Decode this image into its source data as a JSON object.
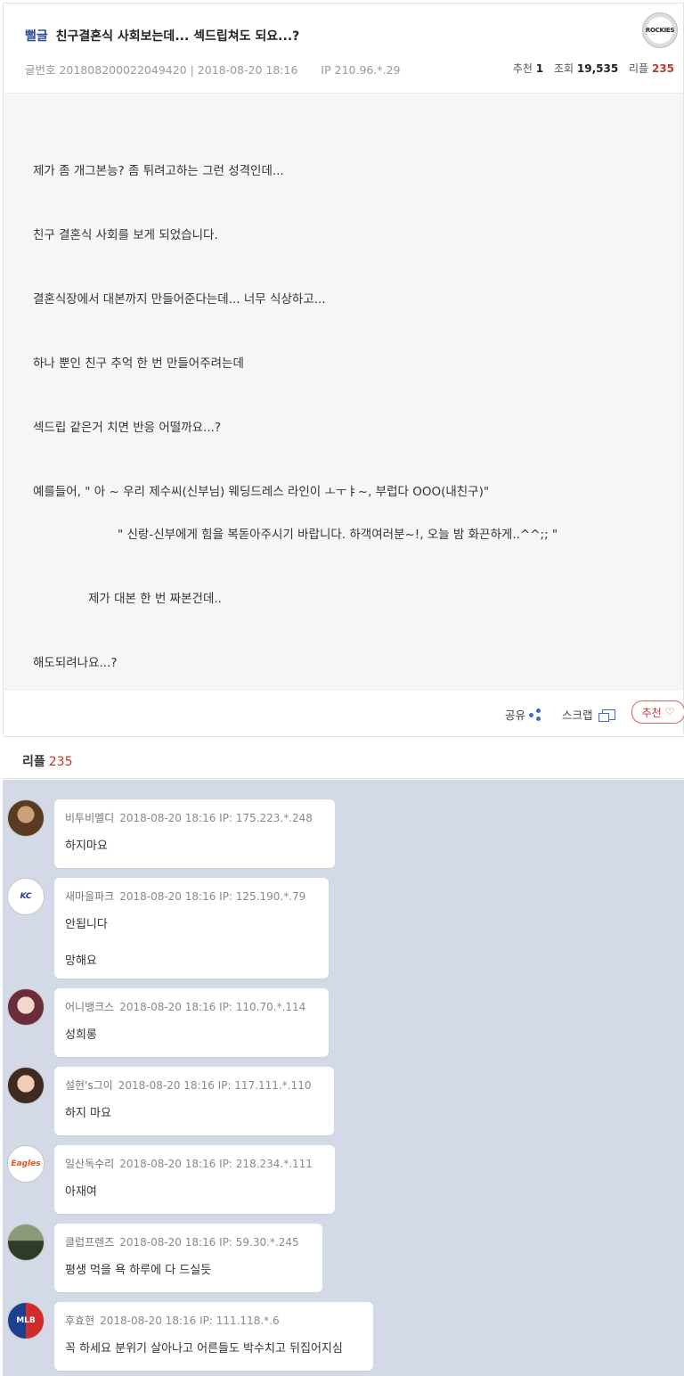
{
  "post": {
    "category": "뻘글",
    "title": "친구결혼식 사회보는데... 섹드립쳐도 되요...?",
    "meta": {
      "number_label": "글번호 201808200022049420 | 2018-08-20 18:16",
      "ip": "IP 210.96.*.29"
    },
    "stats": {
      "recommend_label": "추천",
      "recommend": "1",
      "views_label": "조회",
      "views": "19,535",
      "reply_label": "리플",
      "reply": "235"
    },
    "body": [
      "제가 좀 개그본능? 좀 튀려고하는 그런 성격인데...",
      "친구 결혼식 사회를 보게 되었습니다.",
      "결혼식장에서 대본까지 만들어준다는데... 너무 식상하고...",
      "하나 뿐인 친구 추억 한 번 만들어주려는데",
      "섹드립 같은거 치면 반응 어떨까요...?",
      "예를들어, \" 아 ~ 우리 제수씨(신부님) 웨딩드레스 라인이 ㅗㅜㅑ~, 부럽다 OOO(내친구)\"",
      "\" 신랑-신부에게 힘을 복돋아주시기 바랍니다. 하객여러분~!, 오늘 밤 화끈하게..^^;; \"",
      "제가 대본 한 번 짜본건데..",
      "해도되려나요...?"
    ],
    "actions": {
      "share": "공유",
      "scrap": "스크랩",
      "recommend": "추천"
    },
    "team_logo_text": "ROCKIES"
  },
  "replies": {
    "label": "리플",
    "count": "235",
    "items": [
      {
        "nick": "비투비멜디",
        "meta": "2018-08-20 18:16 IP: 175.223.*.248",
        "lines": [
          "하지마요"
        ],
        "avatar": "photo"
      },
      {
        "nick": "새마을파크",
        "meta": "2018-08-20 18:16 IP: 125.190.*.79",
        "lines": [
          "안됩니다",
          "망해요"
        ],
        "avatar": "Royals"
      },
      {
        "nick": "어니뱅크스",
        "meta": "2018-08-20 18:16 IP: 110.70.*.114",
        "lines": [
          "성희롱"
        ],
        "avatar": "photo"
      },
      {
        "nick": "설현's그이",
        "meta": "2018-08-20 18:16 IP: 117.111.*.110",
        "lines": [
          "하지 마요"
        ],
        "avatar": "photo"
      },
      {
        "nick": "일산독수리",
        "meta": "2018-08-20 18:16 IP: 218.234.*.111",
        "lines": [
          "아재여"
        ],
        "avatar": "Eagles"
      },
      {
        "nick": "클럽프렌즈",
        "meta": "2018-08-20 18:16 IP: 59.30.*.245",
        "lines": [
          "평생 먹을 욕 하루에 다 드실듯"
        ],
        "avatar": "photo"
      },
      {
        "nick": "후효현",
        "meta": "2018-08-20 18:16 IP: 111.118.*.6",
        "lines": [
          "꼭 하세요 분위기 살아나고 어른들도 박수치고 뒤집어지심"
        ],
        "avatar": "MLB"
      }
    ]
  },
  "colors": {
    "category": "#2b4a9c",
    "reply_count": "#c0392b",
    "reply_bg": "#d3d9e7",
    "body_bg": "#f6f6f6"
  }
}
